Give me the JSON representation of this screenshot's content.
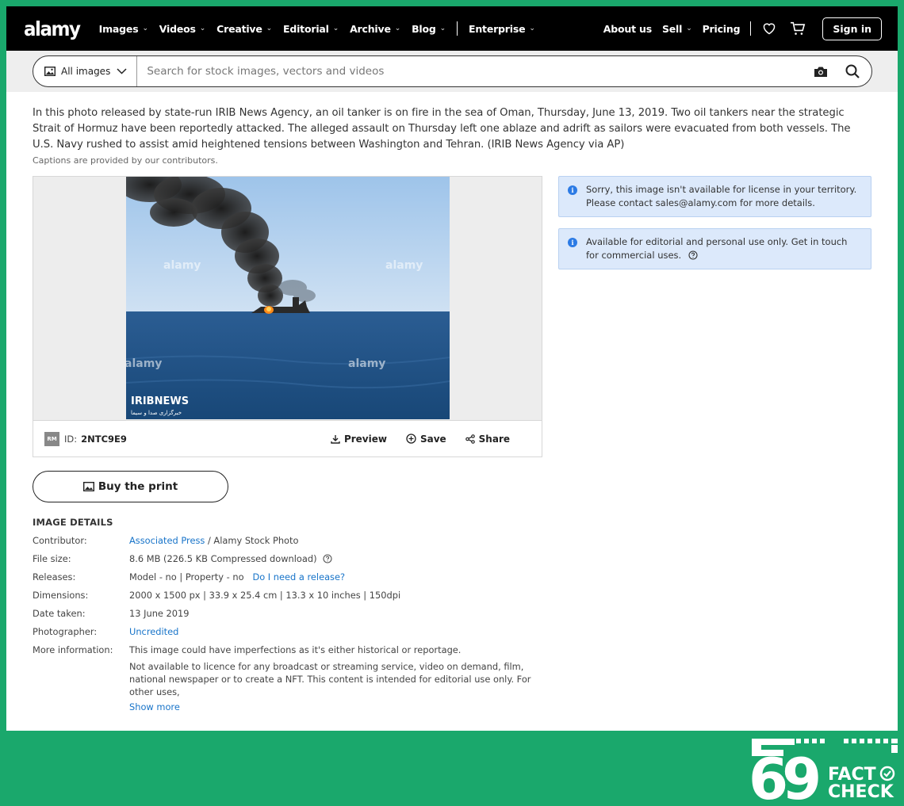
{
  "nav": {
    "logo": "alamy",
    "menu": [
      {
        "label": "Images"
      },
      {
        "label": "Videos"
      },
      {
        "label": "Creative"
      },
      {
        "label": "Editorial"
      },
      {
        "label": "Archive"
      },
      {
        "label": "Blog"
      }
    ],
    "enterprise": "Enterprise",
    "about": "About us",
    "sell": "Sell",
    "pricing": "Pricing",
    "signin": "Sign in"
  },
  "search": {
    "scope": "All images",
    "placeholder": "Search for stock images, vectors and videos"
  },
  "caption": {
    "text": "In this photo released by state-run IRIB News Agency, an oil tanker is on fire in the sea of Oman, Thursday, June 13, 2019. Two oil tankers near the strategic Strait of Hormuz have been reportedly attacked. The alleged assault on Thursday left one ablaze and adrift as sailors were evacuated from both vessels. The U.S. Navy rushed to assist amid heightened tensions between Washington and Tehran. (IRIB News Agency via AP)",
    "note": "Captions are provided by our contributors."
  },
  "image": {
    "watermark": "alamy",
    "broadcaster": "IRIBNEWS",
    "broadcaster_sub": "خبرگزاری صدا و سیما",
    "rm": "RM",
    "id_label": "ID:",
    "id": "2NTC9E9",
    "preview": "Preview",
    "save": "Save",
    "share": "Share"
  },
  "buy": "Buy the print",
  "details": {
    "title": "IMAGE DETAILS",
    "contributor_label": "Contributor:",
    "contributor_link": "Associated Press",
    "contributor_rest": " / Alamy Stock Photo",
    "filesize_label": "File size:",
    "filesize": "8.6 MB (226.5 KB Compressed download)",
    "releases_label": "Releases:",
    "releases": "Model - no | Property - no",
    "releases_link": "Do I need a release?",
    "dimensions_label": "Dimensions:",
    "dimensions": "2000 x 1500 px | 33.9 x 25.4 cm | 13.3 x 10 inches | 150dpi",
    "date_label": "Date taken:",
    "date": "13 June 2019",
    "photographer_label": "Photographer:",
    "photographer": "Uncredited",
    "more_label": "More information:",
    "more_1": "This image could have imperfections as it's either historical or reportage.",
    "more_2": "Not available to licence for any broadcast or streaming service, video on demand, film, national newspaper or to create a NFT. This content is intended for editorial use only. For other uses,",
    "show_more": "Show more"
  },
  "notices": {
    "territory": "Sorry, this image isn't available for license in your territory. Please contact sales@alamy.com for more details.",
    "editorial": "Available for editorial and personal use only. Get in touch for commercial uses."
  },
  "factcheck": {
    "number": "69",
    "word1": "FACT",
    "word2": "CHECK"
  },
  "colors": {
    "frame_bg": "#1aa86c",
    "nav_bg": "#000000",
    "link": "#1874c9",
    "notice_bg": "#dce9fb"
  }
}
